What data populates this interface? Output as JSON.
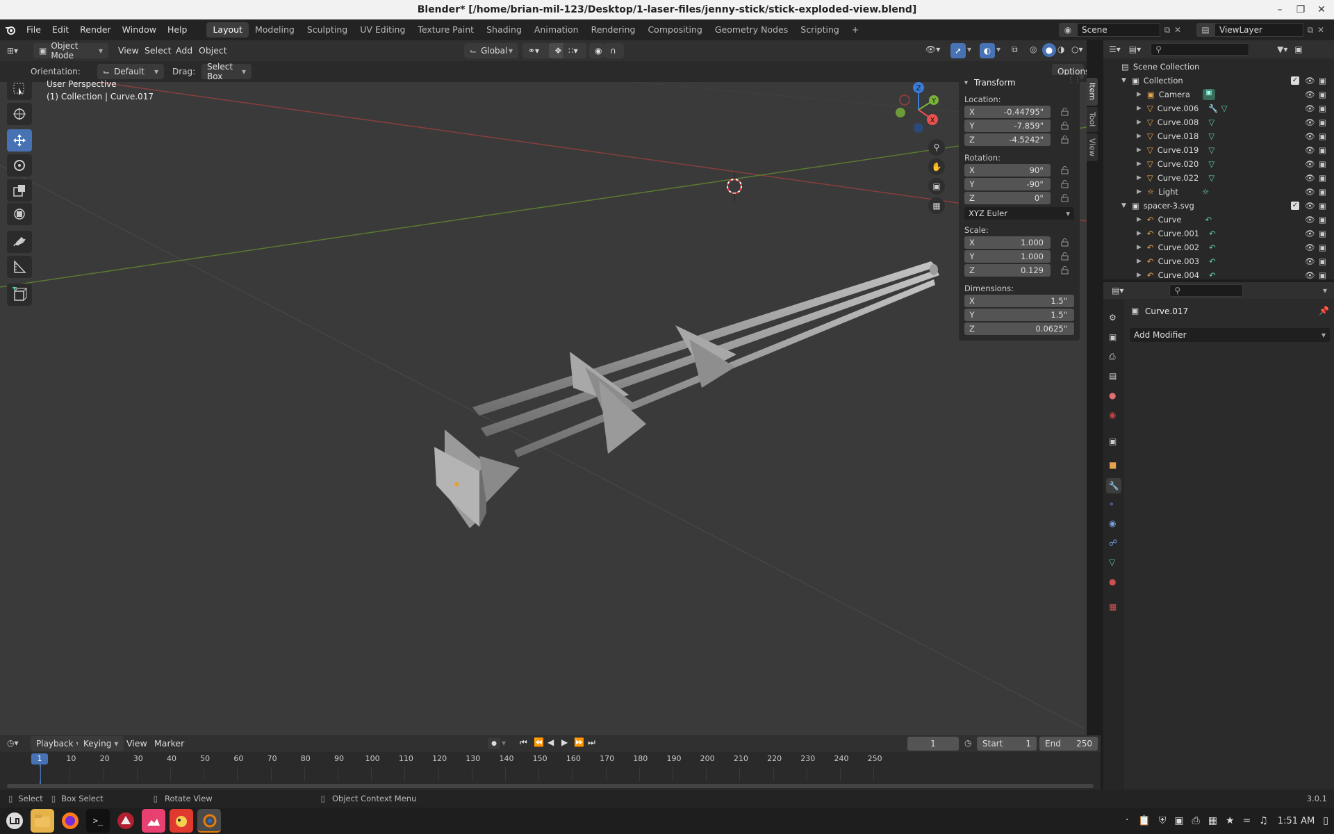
{
  "window": {
    "title": "Blender* [/home/brian-mil-123/Desktop/1-laser-files/jenny-stick/stick-exploded-view.blend]"
  },
  "menubar": {
    "menus": [
      "File",
      "Edit",
      "Render",
      "Window",
      "Help"
    ],
    "workspaces": [
      "Layout",
      "Modeling",
      "Sculpting",
      "UV Editing",
      "Texture Paint",
      "Shading",
      "Animation",
      "Rendering",
      "Compositing",
      "Geometry Nodes",
      "Scripting"
    ],
    "add_tab": "+",
    "scene": "Scene",
    "view_layer": "ViewLayer"
  },
  "viewport_header": {
    "mode": "Object Mode",
    "menus": [
      "View",
      "Select",
      "Add",
      "Object"
    ],
    "transform_orientation": "Global",
    "orientation_label": "Orientation:",
    "orientation_value": "Default",
    "drag_label": "Drag:",
    "drag_value": "Select Box",
    "options": "Options"
  },
  "viewport": {
    "perspective": "User Perspective",
    "context": "(1) Collection | Curve.017",
    "gizmo": {
      "x": "X",
      "y": "Y",
      "z": "Z"
    }
  },
  "npanel": {
    "tabs": [
      "Item",
      "Tool",
      "View"
    ],
    "section": "Transform",
    "location_label": "Location:",
    "location": [
      {
        "axis": "X",
        "value": "-0.44795\""
      },
      {
        "axis": "Y",
        "value": "-7.859\""
      },
      {
        "axis": "Z",
        "value": "-4.5242\""
      }
    ],
    "rotation_label": "Rotation:",
    "rotation": [
      {
        "axis": "X",
        "value": "90°"
      },
      {
        "axis": "Y",
        "value": "-90°"
      },
      {
        "axis": "Z",
        "value": "0°"
      }
    ],
    "rotation_mode": "XYZ Euler",
    "scale_label": "Scale:",
    "scale": [
      {
        "axis": "X",
        "value": "1.000"
      },
      {
        "axis": "Y",
        "value": "1.000"
      },
      {
        "axis": "Z",
        "value": "0.129"
      }
    ],
    "dimensions_label": "Dimensions:",
    "dimensions": [
      {
        "axis": "X",
        "value": "1.5\""
      },
      {
        "axis": "Y",
        "value": "1.5\""
      },
      {
        "axis": "Z",
        "value": "0.0625\""
      }
    ]
  },
  "outliner": {
    "rows": [
      {
        "label": "Scene Collection",
        "type": "scene",
        "depth": 0
      },
      {
        "label": "Collection",
        "type": "collection",
        "depth": 1
      },
      {
        "label": "Camera",
        "type": "camera",
        "depth": 2
      },
      {
        "label": "Curve.006",
        "type": "mesh",
        "depth": 2
      },
      {
        "label": "Curve.008",
        "type": "mesh",
        "depth": 2
      },
      {
        "label": "Curve.018",
        "type": "mesh",
        "depth": 2
      },
      {
        "label": "Curve.019",
        "type": "mesh",
        "depth": 2
      },
      {
        "label": "Curve.020",
        "type": "mesh",
        "depth": 2
      },
      {
        "label": "Curve.022",
        "type": "mesh",
        "depth": 2
      },
      {
        "label": "Light",
        "type": "light",
        "depth": 2
      },
      {
        "label": "spacer-3.svg",
        "type": "collection",
        "depth": 1
      },
      {
        "label": "Curve",
        "type": "curve",
        "depth": 2
      },
      {
        "label": "Curve.001",
        "type": "curve",
        "depth": 2
      },
      {
        "label": "Curve.002",
        "type": "curve",
        "depth": 2
      },
      {
        "label": "Curve.003",
        "type": "curve",
        "depth": 2
      },
      {
        "label": "Curve.004",
        "type": "curve",
        "depth": 2
      }
    ]
  },
  "properties": {
    "object_name": "Curve.017",
    "add_modifier": "Add Modifier"
  },
  "timeline": {
    "menus": [
      "Playback",
      "Keying",
      "View",
      "Marker"
    ],
    "current_frame": "1",
    "start_label": "Start",
    "start": "1",
    "end_label": "End",
    "end": "250",
    "ticks": [
      "1",
      "10",
      "20",
      "30",
      "40",
      "50",
      "60",
      "70",
      "80",
      "90",
      "100",
      "110",
      "120",
      "130",
      "140",
      "150",
      "160",
      "170",
      "180",
      "190",
      "200",
      "210",
      "220",
      "230",
      "240",
      "250"
    ]
  },
  "statusbar": {
    "select": "Select",
    "box_select": "Box Select",
    "rotate_view": "Rotate View",
    "context_menu": "Object Context Menu",
    "version": "3.0.1"
  },
  "taskbar": {
    "clock": "1:51 AM"
  },
  "colors": {
    "accent": "#4772b3",
    "mesh_icon": "#e6a34a",
    "data_icon": "#5fcfa0",
    "x_axis": "#e4514f",
    "y_axis": "#7ab33a",
    "z_axis": "#3b7bd8"
  }
}
